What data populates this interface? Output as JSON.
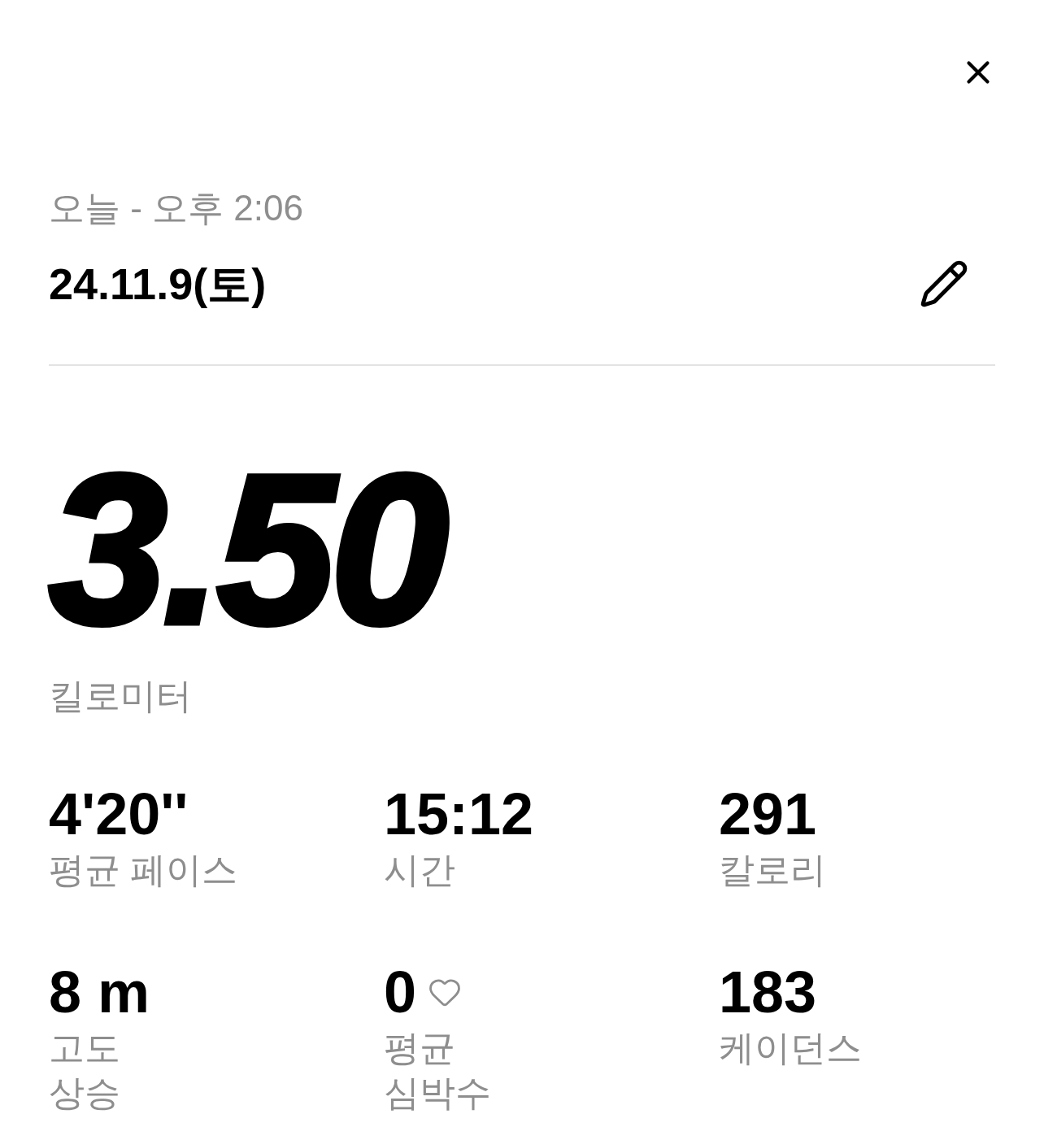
{
  "header": {
    "subtitle": "오늘 - 오후 2:06",
    "date": "24.11.9(토)"
  },
  "distance": {
    "value": "3.50",
    "unit": "킬로미터"
  },
  "stats": [
    {
      "kind": "plain",
      "value": "4'20''",
      "label": [
        "평균 페이스"
      ]
    },
    {
      "kind": "plain",
      "value": "15:12",
      "label": [
        "시간"
      ]
    },
    {
      "kind": "plain",
      "value": "291",
      "label": [
        "칼로리"
      ]
    },
    {
      "kind": "plain",
      "value": "8 m",
      "label": [
        "고도",
        "상승"
      ]
    },
    {
      "kind": "heart",
      "value": "0",
      "label": [
        "평균",
        "심박수"
      ]
    },
    {
      "kind": "plain",
      "value": "183",
      "label": [
        "케이던스"
      ]
    }
  ]
}
